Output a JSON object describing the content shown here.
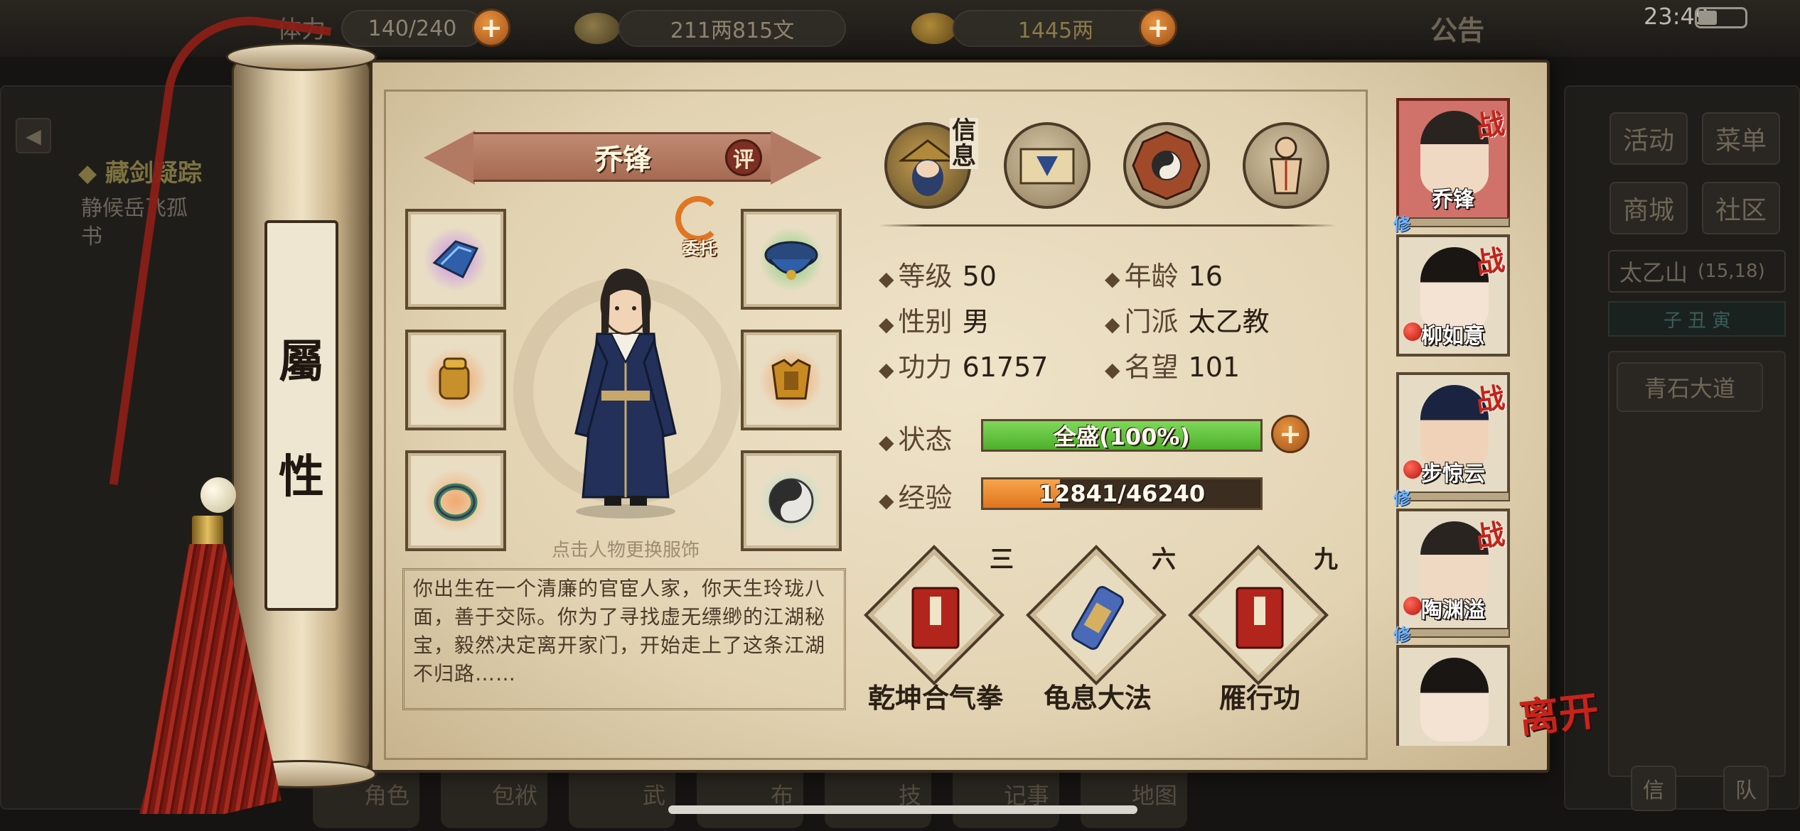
{
  "status_bar": {
    "time": "23:49"
  },
  "top_bar": {
    "stamina_label": "体力",
    "stamina_value": "140/240",
    "silver_value": "211两815文",
    "gold_value": "1445两",
    "notice_label": "公告"
  },
  "left_quest": {
    "title": "◆ 藏剑疑踪",
    "desc": "静候岳飞孤",
    "desc2": "书"
  },
  "right_menu": {
    "activity": "活动",
    "menu": "菜单",
    "shop": "商城",
    "community": "社区",
    "location": "太乙山",
    "coords": "(15,18)",
    "time_marks": "子 丑 寅",
    "road": "青石大道",
    "btn_a": "信",
    "btn_b": "队"
  },
  "bottom_nav": [
    "角色",
    "包袱",
    "武",
    "布",
    "技",
    "记事",
    "地图"
  ],
  "scroll_label": {
    "char1": "屬",
    "char2": "性"
  },
  "character": {
    "name": "乔锋",
    "rate_badge": "评",
    "entrust_label": "委托",
    "hint": "点击人物更换服饰",
    "bio": "你出生在一个清廉的官宦人家，你天生玲珑八面，善于交际。你为了寻找虚无缥缈的江湖秘宝，毅然决定离开家门，开始走上了这条江湖不归路……"
  },
  "tabs": {
    "info_label": "信息"
  },
  "stats": {
    "level_label": "等级",
    "level": "50",
    "age_label": "年龄",
    "age": "16",
    "gender_label": "性别",
    "gender": "男",
    "sect_label": "门派",
    "sect": "太乙教",
    "power_label": "功力",
    "power": "61757",
    "fame_label": "名望",
    "fame": "101",
    "state_label": "状态",
    "state": "全盛(100%)",
    "state_ratio": 1.0,
    "exp_label": "经验",
    "exp": "12841/46240",
    "exp_ratio": 0.2777
  },
  "skills": [
    {
      "level": "三",
      "name": "乾坤合气拳"
    },
    {
      "level": "六",
      "name": "龟息大法"
    },
    {
      "level": "九",
      "name": "雁行功"
    }
  ],
  "roster": [
    {
      "name": "乔锋",
      "war": "战",
      "xiu": "修"
    },
    {
      "name": "柳如意",
      "war": "战"
    },
    {
      "name": "步惊云",
      "war": "战",
      "xiu": "修"
    },
    {
      "name": "陶渊溢",
      "war": "战",
      "xiu": "修"
    },
    {
      "name": ""
    }
  ],
  "leave_label": "离开",
  "colors": {
    "state_bar": "#4caf2a",
    "exp_bar": "#e0741c",
    "accent_red": "#c2231a"
  }
}
